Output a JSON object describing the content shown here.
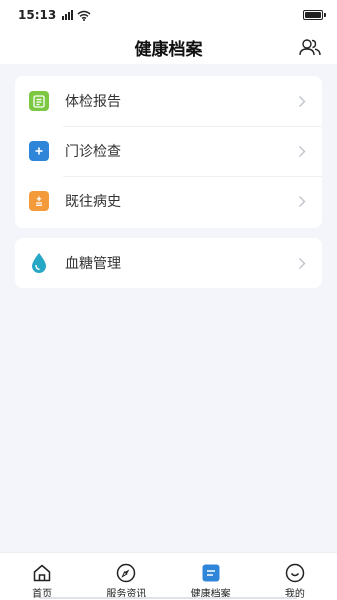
{
  "status_bar": {
    "time": "15:13"
  },
  "header": {
    "title": "健康档案",
    "right_icon": "users-icon"
  },
  "menu_group_1": [
    {
      "label": "体检报告",
      "icon": "report-icon",
      "color": "#7cc843"
    },
    {
      "label": "门诊检查",
      "icon": "medical-kit-icon",
      "color": "#2f86d8"
    },
    {
      "label": "既往病史",
      "icon": "history-icon",
      "color": "#f39a3a"
    }
  ],
  "menu_group_2": [
    {
      "label": "血糖管理",
      "icon": "drop-icon",
      "color": "#26a7c6"
    }
  ],
  "tabbar": {
    "tabs": [
      {
        "label": "首页",
        "icon": "home-icon"
      },
      {
        "label": "服务资讯",
        "icon": "compass-icon"
      },
      {
        "label": "健康档案",
        "icon": "record-icon",
        "active": true
      },
      {
        "label": "我的",
        "icon": "smile-icon"
      }
    ]
  }
}
